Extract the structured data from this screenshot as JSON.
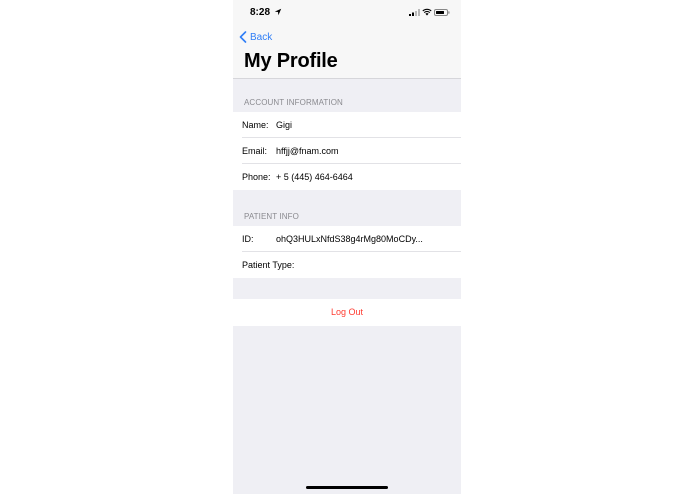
{
  "status_bar": {
    "time": "8:28"
  },
  "nav": {
    "back_label": "Back",
    "title": "My Profile"
  },
  "account_section": {
    "header": "ACCOUNT INFORMATION",
    "rows": [
      {
        "label": "Name:",
        "value": "Gigi"
      },
      {
        "label": "Email:",
        "value": "hffjj@fnam.com"
      },
      {
        "label": "Phone:",
        "value": "+ 5 (445) 464-6464"
      }
    ]
  },
  "patient_section": {
    "header": "PATIENT INFO",
    "rows": [
      {
        "label": "ID:",
        "value": "ohQ3HULxNfdS38g4rMg80MoCDy..."
      },
      {
        "label": "Patient Type:",
        "value": ""
      }
    ]
  },
  "logout_label": "Log Out",
  "colors": {
    "accent": "#2f7ef6",
    "destructive": "#ff3b30",
    "background": "#efeff4"
  },
  "icons": [
    "location-arrow-icon",
    "cellular-signal-icon",
    "wifi-icon",
    "battery-icon",
    "chevron-left-icon"
  ]
}
